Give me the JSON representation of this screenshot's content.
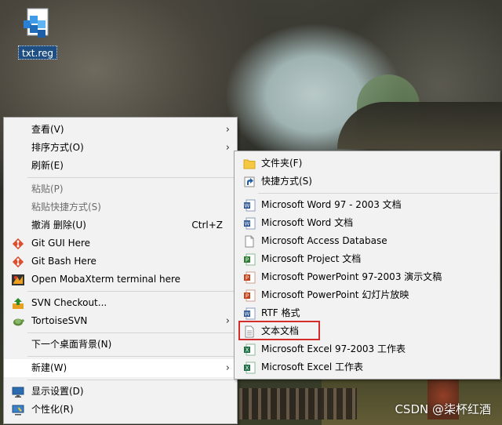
{
  "desktop": {
    "icon_label": "txt.reg",
    "watermark": "CSDN @柒杯红酒"
  },
  "context_menu": {
    "items": [
      {
        "label": "查看(V)"
      },
      {
        "label": "排序方式(O)"
      },
      {
        "label": "刷新(E)"
      },
      {
        "label": "粘贴(P)"
      },
      {
        "label": "粘贴快捷方式(S)"
      },
      {
        "label": "撤消 删除(U)",
        "shortcut": "Ctrl+Z"
      },
      {
        "label": "Git GUI Here"
      },
      {
        "label": "Git Bash Here"
      },
      {
        "label": "Open MobaXterm terminal here"
      },
      {
        "label": "SVN Checkout..."
      },
      {
        "label": "TortoiseSVN"
      },
      {
        "label": "下一个桌面背景(N)"
      },
      {
        "label": "新建(W)"
      },
      {
        "label": "显示设置(D)"
      },
      {
        "label": "个性化(R)"
      }
    ]
  },
  "new_submenu": {
    "items": [
      {
        "label": "文件夹(F)"
      },
      {
        "label": "快捷方式(S)"
      },
      {
        "label": "Microsoft Word 97 - 2003 文档"
      },
      {
        "label": "Microsoft Word 文档"
      },
      {
        "label": "Microsoft Access Database"
      },
      {
        "label": "Microsoft Project 文档"
      },
      {
        "label": "Microsoft PowerPoint 97-2003 演示文稿"
      },
      {
        "label": "Microsoft PowerPoint 幻灯片放映"
      },
      {
        "label": "RTF 格式"
      },
      {
        "label": "文本文档"
      },
      {
        "label": "Microsoft Excel 97-2003 工作表"
      },
      {
        "label": "Microsoft Excel 工作表"
      }
    ]
  },
  "icons": {
    "view": "none",
    "sort": "none",
    "refresh": "none",
    "git_gui": "git-diamond-icon",
    "git_bash": "git-diamond-icon",
    "mobaxterm": "mobaxterm-icon",
    "svn_checkout": "svn-checkout-icon",
    "tortoisesvn": "tortoisesvn-icon",
    "display": "monitor-icon",
    "personalize": "personalize-icon"
  },
  "colors": {
    "highlight_box": "#d42b2b",
    "menu_bg": "#f2f2f2",
    "icon_label_bg": "#1f4f82"
  }
}
